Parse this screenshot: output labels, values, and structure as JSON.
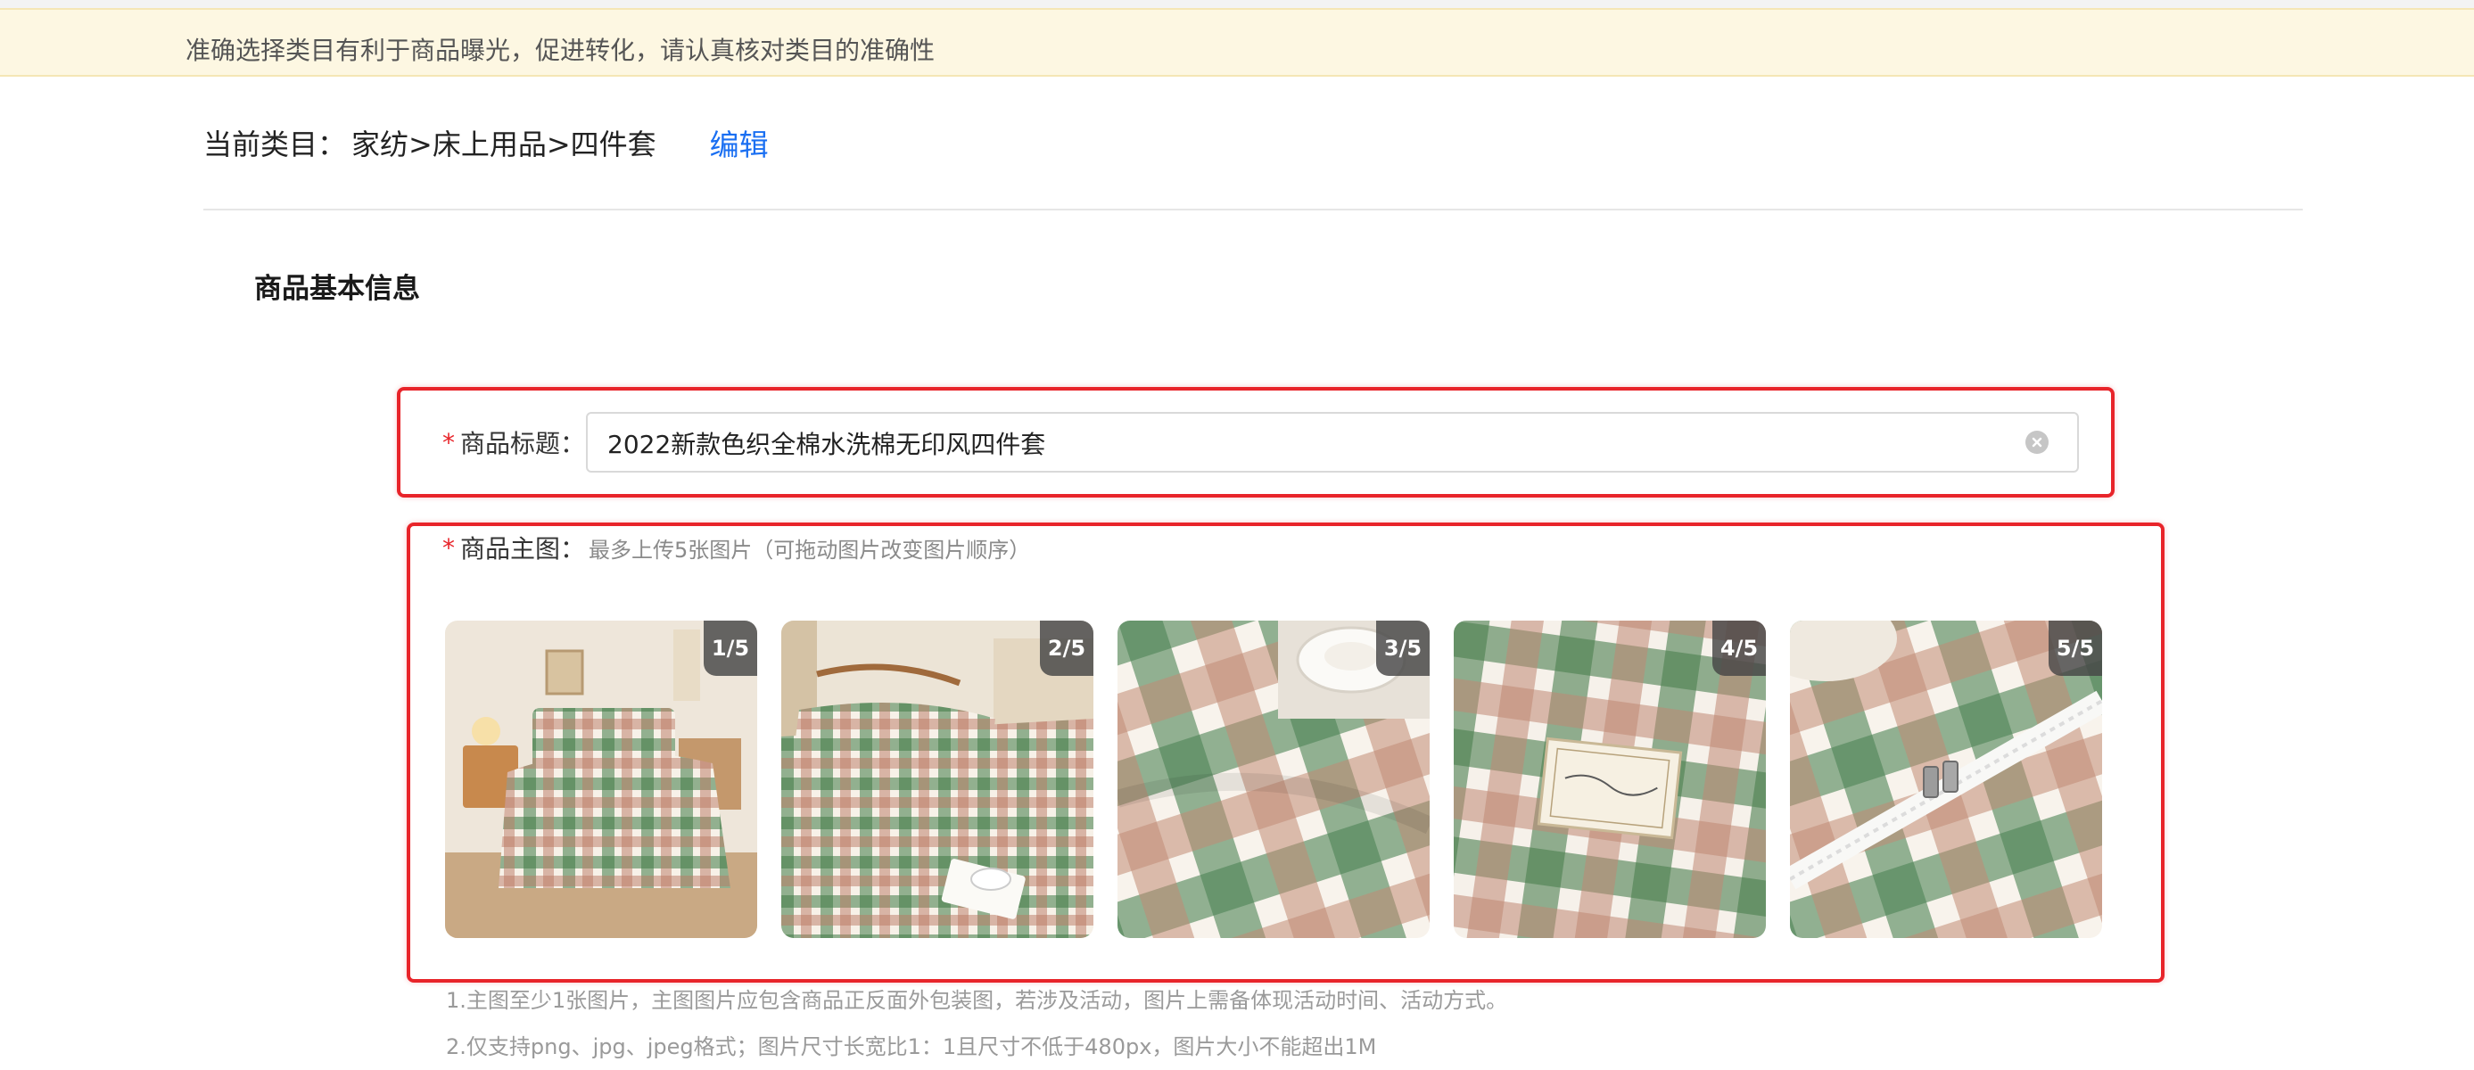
{
  "notice": {
    "text": "准确选择类目有利于商品曝光，促进转化，请认真核对类目的准确性"
  },
  "category": {
    "label": "当前类目：",
    "path": "家纺>床上用品>四件套",
    "edit_label": "编辑"
  },
  "section": {
    "title": "商品基本信息"
  },
  "product_title": {
    "required_mark": "*",
    "label": "商品标题：",
    "value": "2022新款色织全棉水洗棉无印风四件套"
  },
  "main_images": {
    "required_mark": "*",
    "label": "商品主图：",
    "hint": "最多上传5张图片（可拖动图片改变图片顺序）",
    "images": [
      {
        "badge": "1/5"
      },
      {
        "badge": "2/5"
      },
      {
        "badge": "3/5"
      },
      {
        "badge": "4/5"
      },
      {
        "badge": "5/5"
      }
    ],
    "notes": [
      "1.主图至少1张图片，主图图片应包含商品正反面外包装图，若涉及活动，图片上需备体现活动时间、活动方式。",
      "2.仅支持png、jpg、jpeg格式；图片尺寸长宽比1：1且尺寸不低于480px，图片大小不能超出1M"
    ]
  },
  "colors": {
    "accent": "#1a6ff2",
    "required": "#e8242a",
    "notice_bg": "#fdf7e2",
    "highlight_border": "#e8242a"
  }
}
